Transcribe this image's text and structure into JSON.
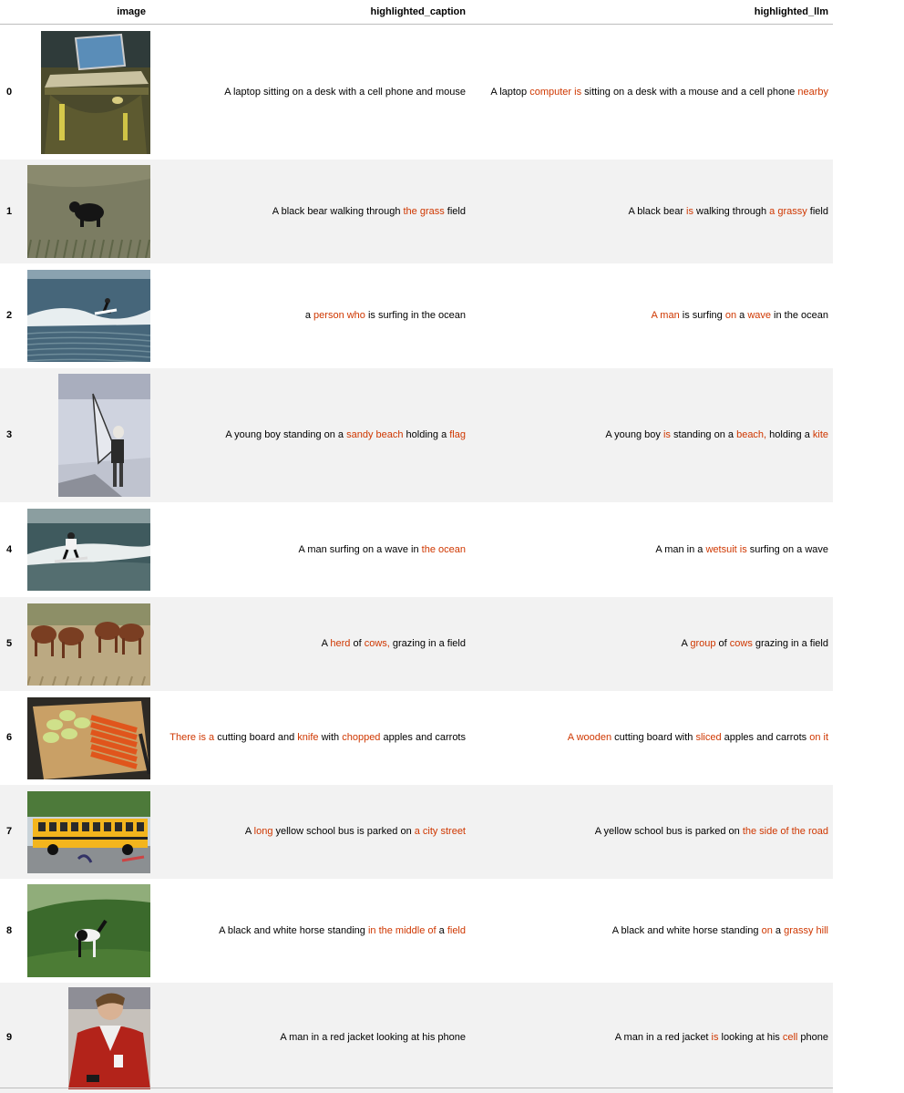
{
  "table": {
    "index_header": "",
    "columns": [
      "image",
      "highlighted_caption",
      "highlighted_llm"
    ],
    "highlight_color": "#cf3700",
    "rows": [
      {
        "index": "0",
        "image": "laptop-on-desk",
        "caption": [
          {
            "t": "A laptop sitting on a desk with a cell phone and mouse",
            "h": false
          }
        ],
        "llm": [
          {
            "t": "A laptop ",
            "h": false
          },
          {
            "t": "computer is",
            "h": true
          },
          {
            "t": " sitting on a desk with a mouse and a cell phone ",
            "h": false
          },
          {
            "t": "nearby",
            "h": true
          }
        ]
      },
      {
        "index": "1",
        "image": "black-bear-in-grass",
        "caption": [
          {
            "t": "A black bear walking through ",
            "h": false
          },
          {
            "t": "the grass",
            "h": true
          },
          {
            "t": " field",
            "h": false
          }
        ],
        "llm": [
          {
            "t": "A black bear ",
            "h": false
          },
          {
            "t": "is",
            "h": true
          },
          {
            "t": " walking through ",
            "h": false
          },
          {
            "t": "a grassy",
            "h": true
          },
          {
            "t": " field",
            "h": false
          }
        ]
      },
      {
        "index": "2",
        "image": "surfer-in-ocean",
        "caption": [
          {
            "t": "a ",
            "h": false
          },
          {
            "t": "person who",
            "h": true
          },
          {
            "t": " is surfing in the ocean",
            "h": false
          }
        ],
        "llm": [
          {
            "t": "A man",
            "h": true
          },
          {
            "t": " is surfing ",
            "h": false
          },
          {
            "t": "on",
            "h": true
          },
          {
            "t": " a ",
            "h": false
          },
          {
            "t": "wave",
            "h": true
          },
          {
            "t": " in the ocean",
            "h": false
          }
        ]
      },
      {
        "index": "3",
        "image": "boy-with-kite-on-beach",
        "caption": [
          {
            "t": "A young boy standing on a ",
            "h": false
          },
          {
            "t": "sandy beach",
            "h": true
          },
          {
            "t": " holding a ",
            "h": false
          },
          {
            "t": "flag",
            "h": true
          }
        ],
        "llm": [
          {
            "t": "A young boy ",
            "h": false
          },
          {
            "t": "is",
            "h": true
          },
          {
            "t": " standing on a ",
            "h": false
          },
          {
            "t": "beach,",
            "h": true
          },
          {
            "t": " holding a ",
            "h": false
          },
          {
            "t": "kite",
            "h": true
          }
        ]
      },
      {
        "index": "4",
        "image": "man-surfing-wave",
        "caption": [
          {
            "t": "A man surfing on a wave in ",
            "h": false
          },
          {
            "t": "the ocean",
            "h": true
          }
        ],
        "llm": [
          {
            "t": "A man in a ",
            "h": false
          },
          {
            "t": "wetsuit is",
            "h": true
          },
          {
            "t": " surfing on a wave",
            "h": false
          }
        ]
      },
      {
        "index": "5",
        "image": "horses-grazing",
        "caption": [
          {
            "t": "A ",
            "h": false
          },
          {
            "t": "herd",
            "h": true
          },
          {
            "t": " of ",
            "h": false
          },
          {
            "t": "cows,",
            "h": true
          },
          {
            "t": " grazing in a field",
            "h": false
          }
        ],
        "llm": [
          {
            "t": "A ",
            "h": false
          },
          {
            "t": "group",
            "h": true
          },
          {
            "t": " of ",
            "h": false
          },
          {
            "t": "cows",
            "h": true
          },
          {
            "t": " grazing in a field",
            "h": false
          }
        ]
      },
      {
        "index": "6",
        "image": "cutting-board-apples-carrots",
        "caption": [
          {
            "t": "There is a",
            "h": true
          },
          {
            "t": " cutting board and ",
            "h": false
          },
          {
            "t": "knife",
            "h": true
          },
          {
            "t": " with ",
            "h": false
          },
          {
            "t": "chopped",
            "h": true
          },
          {
            "t": " apples and carrots",
            "h": false
          }
        ],
        "llm": [
          {
            "t": "A wooden",
            "h": true
          },
          {
            "t": " cutting board with ",
            "h": false
          },
          {
            "t": "sliced",
            "h": true
          },
          {
            "t": " apples and carrots ",
            "h": false
          },
          {
            "t": "on it",
            "h": true
          }
        ]
      },
      {
        "index": "7",
        "image": "yellow-school-bus",
        "caption": [
          {
            "t": "A ",
            "h": false
          },
          {
            "t": "long",
            "h": true
          },
          {
            "t": " yellow school bus is parked on ",
            "h": false
          },
          {
            "t": "a city street",
            "h": true
          }
        ],
        "llm": [
          {
            "t": "A yellow school bus is parked on ",
            "h": false
          },
          {
            "t": "the side of the road",
            "h": true
          }
        ]
      },
      {
        "index": "8",
        "image": "horse-on-hill",
        "caption": [
          {
            "t": "A black and white horse standing ",
            "h": false
          },
          {
            "t": "in the middle of",
            "h": true
          },
          {
            "t": " a ",
            "h": false
          },
          {
            "t": "field",
            "h": true
          }
        ],
        "llm": [
          {
            "t": "A black and white horse standing ",
            "h": false
          },
          {
            "t": "on",
            "h": true
          },
          {
            "t": " a ",
            "h": false
          },
          {
            "t": "grassy hill",
            "h": true
          }
        ]
      },
      {
        "index": "9",
        "image": "man-red-jacket-phone",
        "caption": [
          {
            "t": "A man in a red jacket looking at his phone",
            "h": false
          }
        ],
        "llm": [
          {
            "t": "A man in a red jacket ",
            "h": false
          },
          {
            "t": "is",
            "h": true
          },
          {
            "t": " looking at his ",
            "h": false
          },
          {
            "t": "cell",
            "h": true
          },
          {
            "t": " phone",
            "h": false
          }
        ]
      }
    ]
  }
}
